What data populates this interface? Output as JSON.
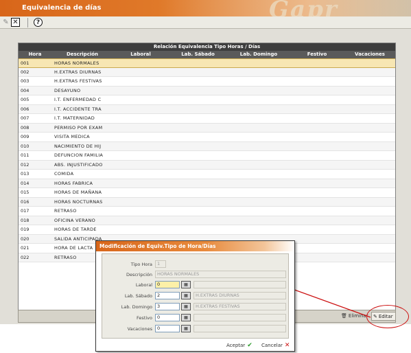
{
  "window": {
    "title": "Equivalencia de días",
    "logo_text": "Gapr"
  },
  "toolbar": {
    "icons": [
      "pencil-icon",
      "close-icon",
      "help-icon"
    ]
  },
  "grid": {
    "title": "Relación Equivalencia Tipo Horas / Días",
    "columns": [
      "Hora",
      "Descripción",
      "Laboral",
      "Lab. Sábado",
      "Lab. Domingo",
      "Festivo",
      "Vacaciones"
    ],
    "rows": [
      {
        "hora": "001",
        "desc": "HORAS NORMALES"
      },
      {
        "hora": "002",
        "desc": "H.EXTRAS DIURNAS"
      },
      {
        "hora": "003",
        "desc": "H.EXTRAS FESTIVAS"
      },
      {
        "hora": "004",
        "desc": "DESAYUNO"
      },
      {
        "hora": "005",
        "desc": "I.T. ENFERMEDAD C"
      },
      {
        "hora": "006",
        "desc": "I.T. ACCIDENTE TRA"
      },
      {
        "hora": "007",
        "desc": "I.T. MATERNIDAD"
      },
      {
        "hora": "008",
        "desc": "PERMISO POR EXAM"
      },
      {
        "hora": "009",
        "desc": "VISITA MEDICA"
      },
      {
        "hora": "010",
        "desc": "NACIMIENTO DE HIJ"
      },
      {
        "hora": "011",
        "desc": "DEFUNCION FAMILIA"
      },
      {
        "hora": "012",
        "desc": "ABS. INJUSTIFICADO"
      },
      {
        "hora": "013",
        "desc": "COMIDA"
      },
      {
        "hora": "014",
        "desc": "HORAS FABRICA"
      },
      {
        "hora": "015",
        "desc": "HORAS DE MAÑANA"
      },
      {
        "hora": "016",
        "desc": "HORAS NOCTURNAS"
      },
      {
        "hora": "017",
        "desc": "RETRASO"
      },
      {
        "hora": "018",
        "desc": "OFICINA VERANO"
      },
      {
        "hora": "019",
        "desc": "HORAS DE TARDE"
      },
      {
        "hora": "020",
        "desc": "SALIDA ANTICIPADA"
      },
      {
        "hora": "021",
        "desc": "HORA DE LACTA"
      },
      {
        "hora": "022",
        "desc": "RETRASO"
      }
    ],
    "selected_row": 0
  },
  "bottom": {
    "eliminar": "Eliminar",
    "editar": "Editar"
  },
  "dialog": {
    "title": "Modificación de Equiv.Tipo de Hora/Días",
    "fields": {
      "tipo_hora": {
        "label": "Tipo Hora",
        "value": "1"
      },
      "descripcion": {
        "label": "Descripción",
        "value": "HORAS NORMALES"
      },
      "laboral": {
        "label": "Laboral",
        "value": "0",
        "desc": ""
      },
      "lab_sabado": {
        "label": "Lab. Sábado",
        "value": "2",
        "desc": "H.EXTRAS DIURNAS"
      },
      "lab_domingo": {
        "label": "Lab. Domingo",
        "value": "3",
        "desc": "H.EXTRAS FESTIVAS"
      },
      "festivo": {
        "label": "Festivo",
        "value": "0",
        "desc": ""
      },
      "vacaciones": {
        "label": "Vacaciones",
        "value": "0",
        "desc": ""
      }
    },
    "aceptar": "Aceptar",
    "cancelar": "Cancelar"
  },
  "colors": {
    "accent": "#d8661a",
    "selected_row": "#f7e6b3",
    "annotation": "#cc1111"
  }
}
